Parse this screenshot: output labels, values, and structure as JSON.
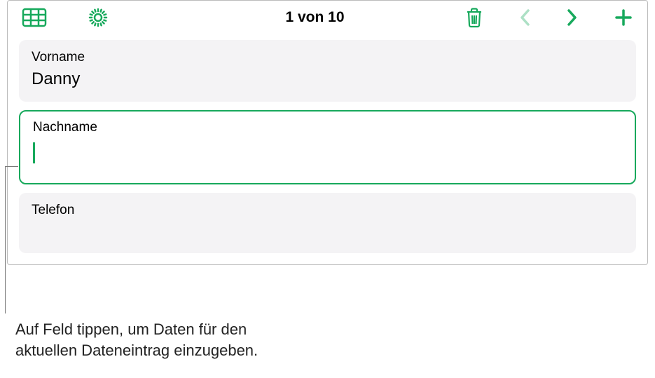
{
  "toolbar": {
    "record_counter": "1 von 10"
  },
  "fields": [
    {
      "label": "Vorname",
      "value": "Danny",
      "active": false
    },
    {
      "label": "Nachname",
      "value": "",
      "active": true
    },
    {
      "label": "Telefon",
      "value": "",
      "active": false
    }
  ],
  "callout": {
    "line1": "Auf Feld tippen, um Daten für den",
    "line2": "aktuellen Dateneintrag einzugeben."
  },
  "colors": {
    "accent": "#17a95c"
  }
}
